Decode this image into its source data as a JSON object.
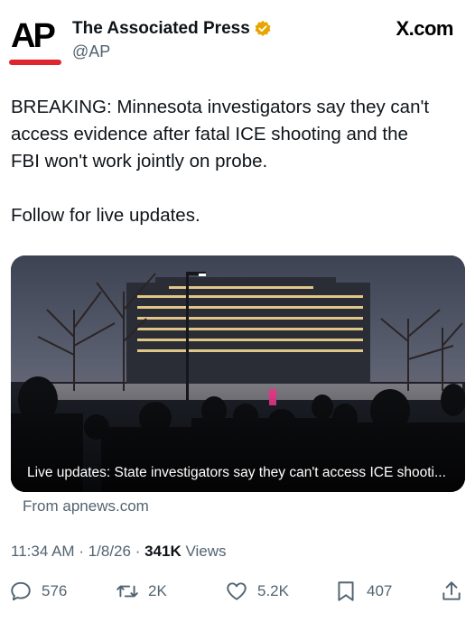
{
  "header": {
    "logo_text": "AP",
    "account_name": "The Associated Press",
    "handle": "@AP",
    "site_label": "X.com"
  },
  "tweet": {
    "text": "BREAKING: Minnesota investigators say they can't\naccess evidence after fatal ICE shooting and the\nFBI won't work jointly on probe.",
    "follow_text": "Follow for live updates."
  },
  "card": {
    "caption": "Live updates: State investigators say they can't access ICE shooti...",
    "source": "From apnews.com"
  },
  "meta": {
    "time": "11:34 AM",
    "date": "1/8/26",
    "views_count": "341K",
    "views_label": "Views"
  },
  "actions": {
    "replies": "576",
    "reposts": "2K",
    "likes": "5.2K",
    "bookmarks": "407"
  },
  "colors": {
    "brand_red": "#e0262d",
    "verified_gold": "#e8a500",
    "text_primary": "#0f1419",
    "text_secondary": "#536471"
  },
  "icons": [
    "verified-badge-icon",
    "reply-icon",
    "repost-icon",
    "like-icon",
    "bookmark-icon",
    "share-icon"
  ]
}
